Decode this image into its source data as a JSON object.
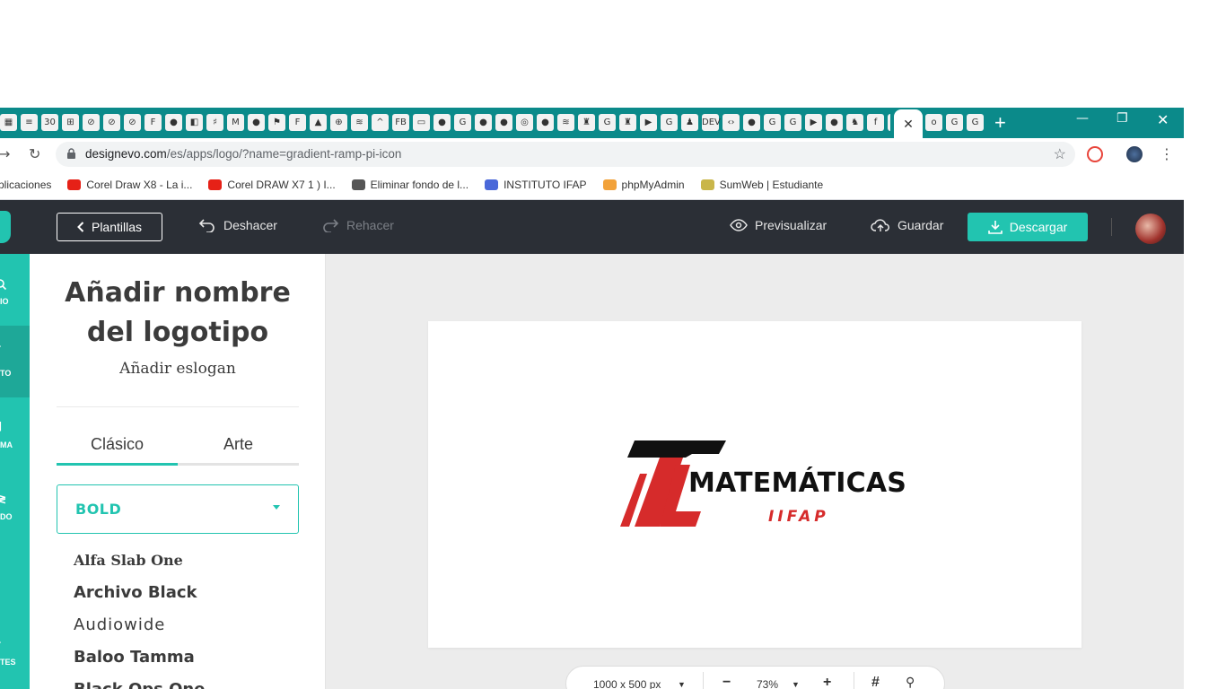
{
  "browser": {
    "tab_favicons": [
      "▦",
      "≡",
      "30",
      "⊞",
      "⊘",
      "⊘",
      "⊘",
      "F",
      "●",
      "◧",
      "♯",
      "M",
      "●",
      "⚑",
      "F",
      "▲",
      "⊕",
      "≋",
      "^",
      "FB",
      "▭",
      "●",
      "G",
      "●",
      "●",
      "◎",
      "●",
      "≋",
      "♜",
      "G",
      "♜",
      "▶",
      "G",
      "♟",
      "DEV",
      "‹›",
      "●",
      "G",
      "G",
      "▶",
      "●",
      "♞",
      "f",
      "G",
      "N"
    ],
    "active_tab_glyph": "✕",
    "more_tab_favicons": [
      "o",
      "G",
      "G"
    ],
    "new_tab": "+",
    "url_host": "designevo.com",
    "url_path": "/es/apps/logo/?name=gradient-ramp-pi-icon",
    "bookmarks": [
      {
        "label": "plicaciones",
        "color": "#ffffff"
      },
      {
        "label": "Corel Draw X8 - La i...",
        "color": "#e62117"
      },
      {
        "label": "Corel DRAW X7 1 ) I...",
        "color": "#e62117"
      },
      {
        "label": "Eliminar fondo de l...",
        "color": "#555555"
      },
      {
        "label": "INSTITUTO IFAP",
        "color": "#4a68d9"
      },
      {
        "label": "phpMyAdmin",
        "color": "#f2a23a"
      },
      {
        "label": "SumWeb | Estudiante",
        "color": "#c9b64a"
      }
    ]
  },
  "header": {
    "templates": "Plantillas",
    "undo": "Deshacer",
    "redo": "Rehacer",
    "preview": "Previsualizar",
    "save": "Guardar",
    "download": "Descargar"
  },
  "rail": {
    "items": [
      {
        "label": "IO",
        "active": false
      },
      {
        "label": "TO",
        "active": true
      },
      {
        "label": "MA",
        "active": false
      },
      {
        "label": "DO",
        "active": false
      },
      {
        "label": "TES",
        "active": false
      }
    ]
  },
  "panel": {
    "title": "Añadir nombre del logotipo",
    "slogan": "Añadir eslogan",
    "tabs": [
      "Clásico",
      "Arte"
    ],
    "font_category": "BOLD",
    "fonts": [
      "Alfa Slab One",
      "Archivo Black",
      "Audiowide",
      "Baloo Tamma",
      "Black Ops One"
    ]
  },
  "canvas": {
    "logo_title": "MATEMÁTICAS",
    "logo_slogan": "IIFAP",
    "logo_colors": {
      "black": "#111111",
      "red": "#d62b2b"
    },
    "size": "1000 x 500 px",
    "zoom": "73%"
  },
  "colors": {
    "accent": "#22c4b0",
    "header_bg": "#2b2f36",
    "tabstrip": "#0b8a8a"
  }
}
